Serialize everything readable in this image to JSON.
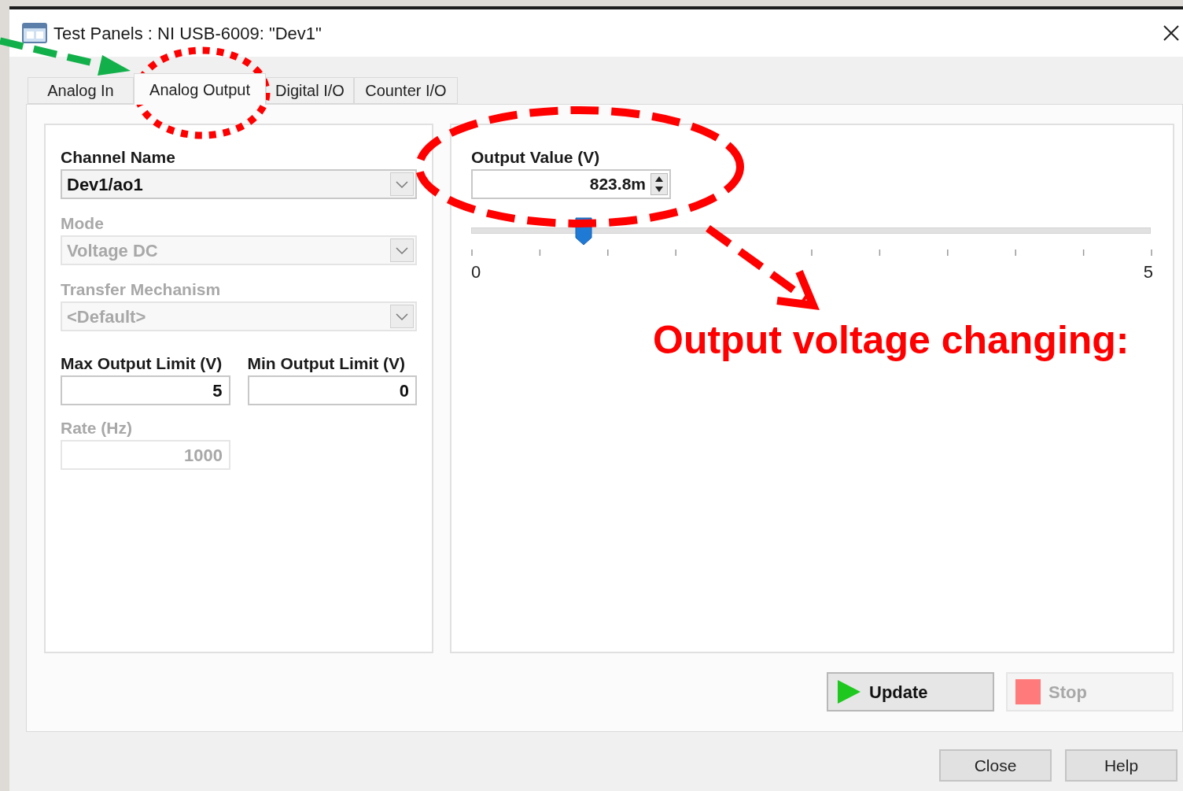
{
  "window": {
    "title": "Test Panels : NI USB-6009: \"Dev1\""
  },
  "tabs": [
    {
      "label": "Analog In",
      "selected": false
    },
    {
      "label": "Analog Output",
      "selected": true
    },
    {
      "label": "Digital I/O",
      "selected": false
    },
    {
      "label": "Counter I/O",
      "selected": false
    }
  ],
  "settings": {
    "fields": [
      {
        "label": "Channel Name",
        "value": "Dev1/ao1",
        "disabled": false
      },
      {
        "label": "Mode",
        "value": "Voltage DC",
        "disabled": true
      },
      {
        "label": "Transfer Mechanism",
        "value": "<Default>",
        "disabled": true
      }
    ],
    "limits": [
      {
        "label": "Max Output Limit (V)",
        "value": "5",
        "disabled": false
      },
      {
        "label": "Min Output Limit (V)",
        "value": "0",
        "disabled": false
      }
    ],
    "rate": {
      "label": "Rate (Hz)",
      "value": "1000",
      "disabled": true
    }
  },
  "output": {
    "label": "Output Value (V)",
    "value": "823.8m",
    "slider": {
      "level": 0.165,
      "min_label": "0",
      "max_label": "5"
    }
  },
  "action_buttons": [
    {
      "label": "Update",
      "kind": "play",
      "disabled": false
    },
    {
      "label": "Stop",
      "kind": "stop",
      "disabled": true
    }
  ],
  "dialog_buttons": [
    "Close",
    "Help"
  ],
  "annotation": {
    "text": "Output voltage changing:"
  }
}
